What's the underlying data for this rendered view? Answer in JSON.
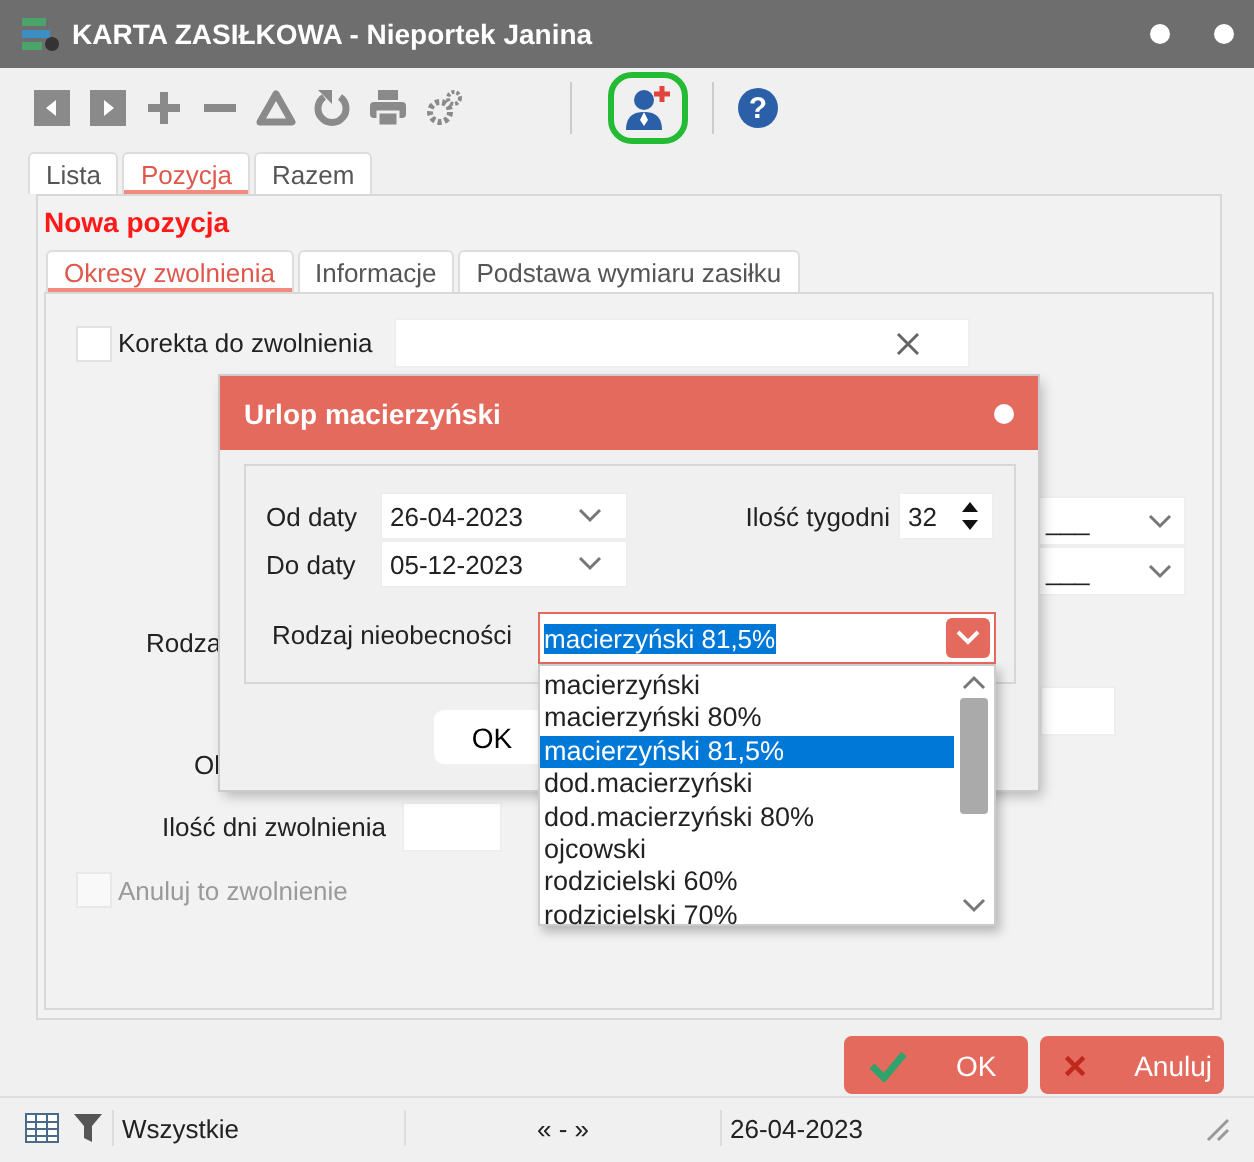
{
  "window": {
    "title": "KARTA ZASIŁKOWA - Nieportek Janina"
  },
  "toolbar": [
    {
      "kind": "prev",
      "highlighted": false
    },
    {
      "kind": "next",
      "highlighted": false
    },
    {
      "kind": "add",
      "highlighted": false
    },
    {
      "kind": "remove",
      "highlighted": false
    },
    {
      "kind": "triangle",
      "highlighted": false
    },
    {
      "kind": "refresh",
      "highlighted": false
    },
    {
      "kind": "print",
      "highlighted": false
    },
    {
      "kind": "settings",
      "highlighted": false
    },
    {
      "kind": "separator"
    },
    {
      "kind": "add-person",
      "highlighted": true
    },
    {
      "kind": "separator"
    },
    {
      "kind": "help",
      "label": "?",
      "highlighted": false
    }
  ],
  "tabs": [
    {
      "label": "Lista",
      "selected": false
    },
    {
      "label": "Pozycja",
      "selected": true
    },
    {
      "label": "Razem",
      "selected": false
    }
  ],
  "section_title": "Nowa pozycja",
  "subtabs": [
    {
      "label": "Okresy zwolnienia",
      "selected": true
    },
    {
      "label": "Informacje",
      "selected": false
    },
    {
      "label": "Podstawa wymiaru zasiłku",
      "selected": false
    }
  ],
  "form": {
    "correction": {
      "label": "Korekta do zwolnienia",
      "checked": false
    },
    "right_fields": [
      {
        "value": "___"
      },
      {
        "value": "___"
      }
    ],
    "covered_label_1": "Rodza",
    "covered_label_2": "Ol",
    "days_label": "Ilość dni zwolnienia",
    "cancel_checkbox": {
      "label": "Anuluj to zwolnienie",
      "checked": false,
      "disabled": true
    }
  },
  "buttons": [
    {
      "kind": "ok",
      "label": "OK"
    },
    {
      "kind": "cancel",
      "label": "Anuluj"
    }
  ],
  "status_bar": {
    "filter": "Wszystkie",
    "nav": "« - »",
    "date": "26-04-2023"
  },
  "dialog": {
    "title": "Urlop macierzyński",
    "from_label": "Od daty",
    "from_value": "26-04-2023",
    "to_label": "Do daty",
    "to_value": "05-12-2023",
    "weeks_label": "Ilość tygodni",
    "weeks_value": "32",
    "absence_label": "Rodzaj nieobecności",
    "absence_value": "macierzyński 81,5%",
    "ok_label": "OK",
    "dropdown_open": true,
    "options": [
      {
        "label": "macierzyński",
        "selected": false
      },
      {
        "label": "macierzyński 80%",
        "selected": false
      },
      {
        "label": "macierzyński 81,5%",
        "selected": true
      },
      {
        "label": "dod.macierzyński",
        "selected": false
      },
      {
        "label": "dod.macierzyński 80%",
        "selected": false
      },
      {
        "label": "ojcowski",
        "selected": false
      },
      {
        "label": "rodzicielski 60%",
        "selected": false
      },
      {
        "label": "rodzicielski 70%",
        "selected": false
      }
    ]
  }
}
